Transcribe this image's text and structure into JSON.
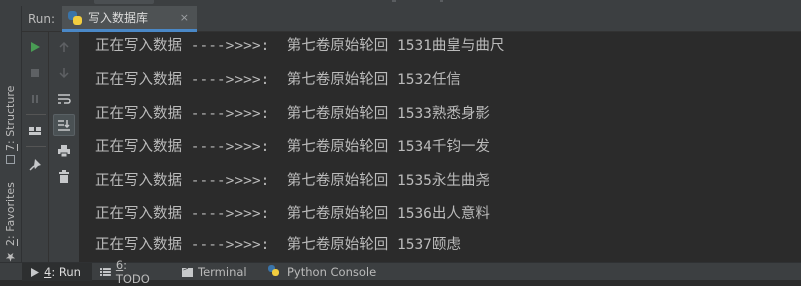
{
  "run_panel": {
    "header_label": "Run:",
    "config_tab": {
      "label": "写入数据库",
      "close_glyph": "×",
      "icon": "python-file-icon"
    }
  },
  "left_stripe": {
    "structure": {
      "number": "7",
      "label": ": Structure"
    },
    "favorites": {
      "number": "2",
      "label": ": Favorites"
    }
  },
  "toolbar_icons": [
    "run-icon",
    "stop-icon",
    "pause-icon",
    "layout-icon",
    "pin-icon",
    "scroll-up-icon",
    "scroll-down-icon",
    "soft-wrap-icon",
    "scroll-to-end-icon",
    "print-icon",
    "trash-icon"
  ],
  "console": {
    "lines": [
      "正在写入数据 ---->>>>:  第七卷原始轮回 1531曲皇与曲尺",
      "正在写入数据 ---->>>>:  第七卷原始轮回 1532任信",
      "正在写入数据 ---->>>>:  第七卷原始轮回 1533熟悉身影",
      "正在写入数据 ---->>>>:  第七卷原始轮回 1534千钧一发",
      "正在写入数据 ---->>>>:  第七卷原始轮回 1535永生曲尧",
      "正在写入数据 ---->>>>:  第七卷原始轮回 1536出人意料",
      "正在写入数据 ---->>>>:  第七卷原始轮回 1537颐虑"
    ]
  },
  "bottom_tabs": {
    "run": {
      "number": "4",
      "label": ": Run"
    },
    "todo": {
      "number": "6",
      "label": ": TODO"
    },
    "terminal": {
      "label": "Terminal"
    },
    "python_console": {
      "label": "Python Console"
    }
  },
  "colors": {
    "console_bg": "#2b2b2b",
    "panel_bg": "#3c3f41",
    "text": "#bbbbbb",
    "run_green": "#499c54",
    "tab_underline": "#4a88c7"
  }
}
